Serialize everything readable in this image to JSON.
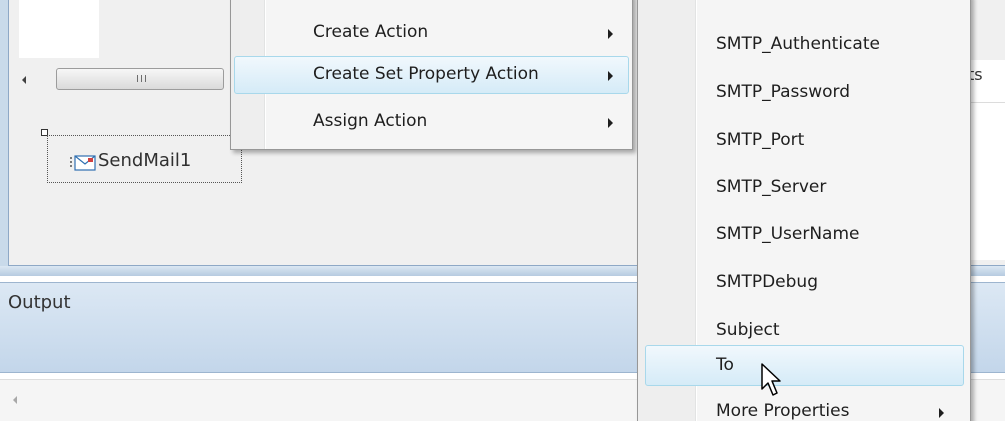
{
  "designer": {
    "component": {
      "icon": "mail-component-icon",
      "label": "SendMail1"
    },
    "scroll_grip": "grip-icon",
    "properties_partial_label": "ts"
  },
  "output_panel": {
    "title": "Output"
  },
  "context_menu": {
    "items": [
      {
        "label": "Create Action",
        "has_submenu": true
      },
      {
        "label": "Create Set Property Action",
        "has_submenu": true,
        "highlighted": true
      },
      {
        "label": "Assign Action",
        "has_submenu": true
      }
    ]
  },
  "property_submenu": {
    "items": [
      {
        "label": "SMTP_Authenticate"
      },
      {
        "label": "SMTP_Password"
      },
      {
        "label": "SMTP_Port"
      },
      {
        "label": "SMTP_Server"
      },
      {
        "label": "SMTP_UserName"
      },
      {
        "label": "SMTPDebug"
      },
      {
        "label": "Subject"
      },
      {
        "label": "To",
        "highlighted": true
      },
      {
        "label": "More Properties",
        "has_submenu": true
      }
    ]
  },
  "colors": {
    "highlight_border": "#a8d8eb",
    "highlight_fill": "#d5ebf7",
    "frame_blue": "#c9daea"
  },
  "cursor": "mouse-pointer-icon"
}
